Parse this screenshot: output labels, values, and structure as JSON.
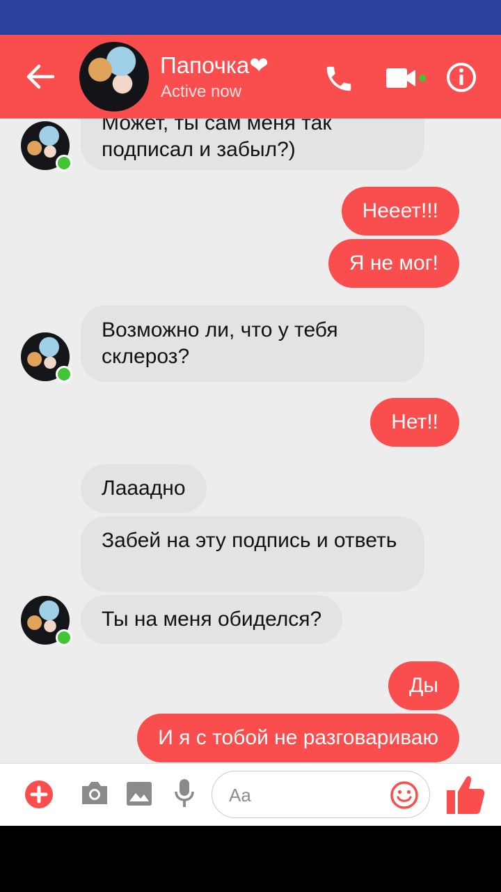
{
  "header": {
    "contact_name": "Папочка❤",
    "contact_status": "Active now",
    "back_icon": "arrow-left-icon",
    "call_icon": "phone-icon",
    "video_icon": "video-camera-icon",
    "info_icon": "info-icon",
    "accent_color": "#fa4d4d",
    "status_bar_color": "#2b3f9c",
    "online_color": "#42c535"
  },
  "messages": [
    {
      "from": "them",
      "text": "Может, ты сам меня так подписал и забыл?)"
    },
    {
      "from": "me",
      "text": "Нееет!!!"
    },
    {
      "from": "me",
      "text": "Я не мог!"
    },
    {
      "from": "them",
      "text": "Возможно ли, что у тебя склероз?"
    },
    {
      "from": "me",
      "text": "Нет!!"
    },
    {
      "from": "them",
      "text": "Лааадно"
    },
    {
      "from": "them",
      "text": "Забей на эту подпись и ответь"
    },
    {
      "from": "them",
      "text": "Ты на меня обиделся?"
    },
    {
      "from": "me",
      "text": "Ды"
    },
    {
      "from": "me",
      "text": "И я с тобой не разговариваю"
    }
  ],
  "composer": {
    "placeholder": "Aa",
    "icons": [
      "plus-icon",
      "camera-icon",
      "image-icon",
      "microphone-icon",
      "emoji-icon",
      "thumbs-up-icon"
    ]
  }
}
